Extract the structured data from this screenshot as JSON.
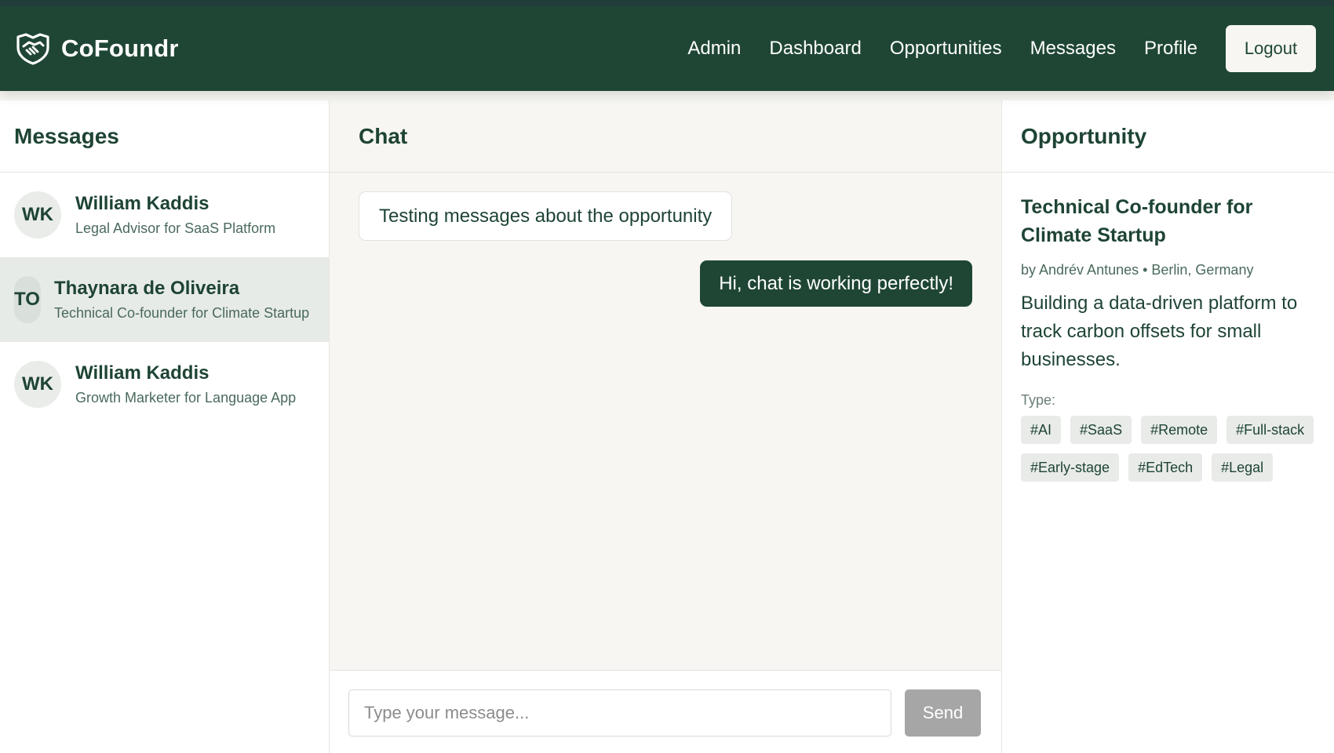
{
  "brand": {
    "name": "CoFoundr",
    "icon": "handshake-shield-icon"
  },
  "nav": {
    "links": [
      "Admin",
      "Dashboard",
      "Opportunities",
      "Messages",
      "Profile"
    ],
    "logout_label": "Logout"
  },
  "messages_panel": {
    "title": "Messages",
    "conversations": [
      {
        "initials": "WK",
        "name": "William Kaddis",
        "subtitle": "Legal Advisor for SaaS Platform"
      },
      {
        "initials": "TO",
        "name": "Thaynara de Oliveira",
        "subtitle": "Technical Co-founder for Climate Startup"
      },
      {
        "initials": "WK",
        "name": "William Kaddis",
        "subtitle": "Growth Marketer for Language App"
      }
    ]
  },
  "chat": {
    "title": "Chat",
    "messages": [
      {
        "direction": "incoming",
        "text": "Testing messages about the opportunity"
      },
      {
        "direction": "outgoing",
        "text": "Hi, chat is working perfectly!"
      }
    ],
    "input_placeholder": "Type your message...",
    "send_label": "Send"
  },
  "opportunity": {
    "panel_title": "Opportunity",
    "title": "Technical Co-founder for Climate Startup",
    "meta": "by Andrév Antunes • Berlin, Germany",
    "description": "Building a data-driven platform to track carbon offsets for small businesses.",
    "type_label": "Type:",
    "tags": [
      "#AI",
      "#SaaS",
      "#Remote",
      "#Full-stack",
      "#Early-stage",
      "#EdTech",
      "#Legal"
    ]
  },
  "colors": {
    "primary": "#1f4634",
    "background": "#f7f6f2",
    "send_disabled": "#a6a6a6"
  }
}
